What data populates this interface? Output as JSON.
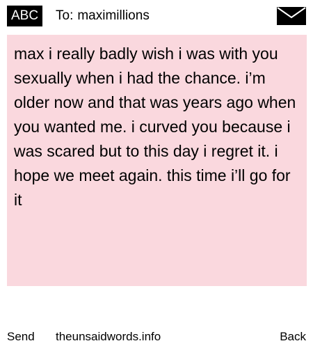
{
  "header": {
    "mode": "ABC",
    "to_label": "To:",
    "recipient": "maximillions",
    "icon": "envelope-icon"
  },
  "message": {
    "text": "max i really badly wish i was with you sexually when i had the chance. i’m older now and that was years ago when you wanted me. i curved you because i was scared but to this day i regret it. i hope we meet again. this time i’ll go for it"
  },
  "footer": {
    "left_softkey": "Send",
    "site": "theunsaidwords.info",
    "right_softkey": "Back"
  },
  "colors": {
    "message_background": "#fad8de",
    "badge_background": "#000000",
    "badge_text": "#ffffff"
  }
}
